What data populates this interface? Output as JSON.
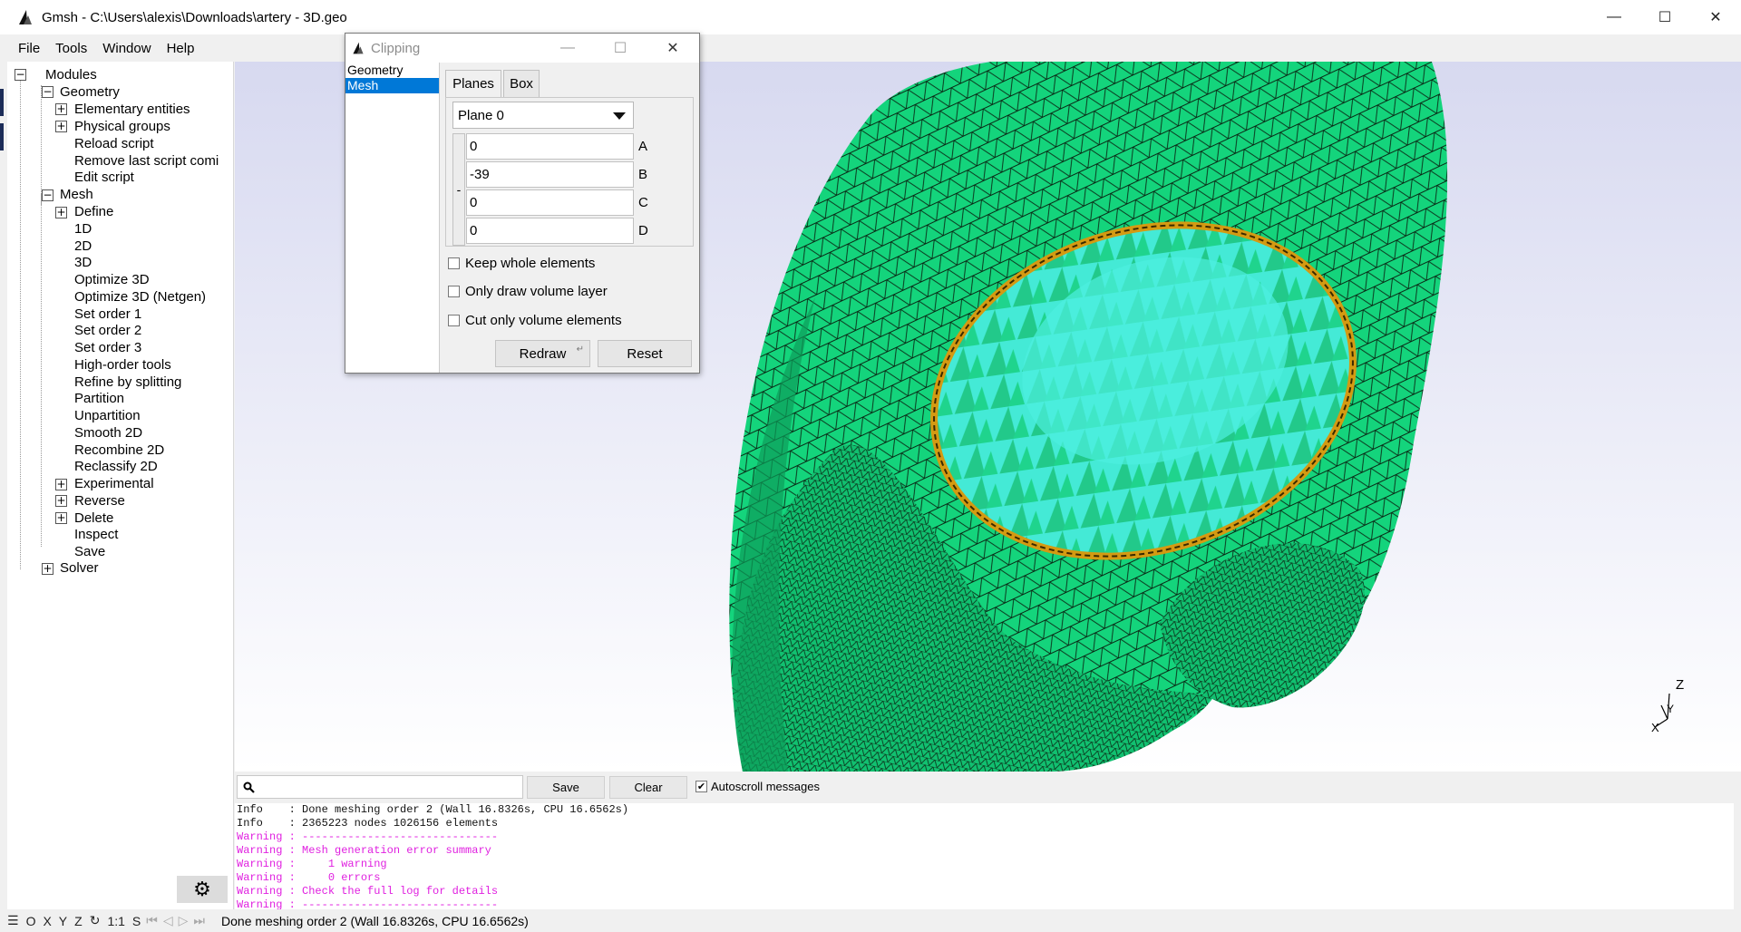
{
  "window": {
    "title": "Gmsh - C:\\Users\\alexis\\Downloads\\artery - 3D.geo",
    "min_symbol": "—",
    "max_symbol": "☐",
    "close_symbol": "✕"
  },
  "menu": {
    "items": [
      "File",
      "Tools",
      "Window",
      "Help"
    ]
  },
  "tree": {
    "modules": "Modules",
    "geometry": "Geometry",
    "geometry_items": [
      "Elementary entities",
      "Physical groups",
      "Reload script",
      "Remove last script comi",
      "Edit script"
    ],
    "mesh": "Mesh",
    "mesh_items": [
      "Define",
      "1D",
      "2D",
      "3D",
      "Optimize 3D",
      "Optimize 3D (Netgen)",
      "Set order 1",
      "Set order 2",
      "Set order 3",
      "High-order tools",
      "Refine by splitting",
      "Partition",
      "Unpartition",
      "Smooth 2D",
      "Recombine 2D",
      "Reclassify 2D",
      "Experimental",
      "Reverse",
      "Delete",
      "Inspect",
      "Save"
    ],
    "solver": "Solver",
    "plus": "+",
    "minus": "−"
  },
  "messages": {
    "save_label": "Save",
    "clear_label": "Clear",
    "autoscroll_label": "Autoscroll messages",
    "autoscroll_checked": "✔",
    "lines": [
      {
        "type": "info",
        "text": "Info    : Done meshing order 2 (Wall 16.8326s, CPU 16.6562s)"
      },
      {
        "type": "info",
        "text": "Info    : 2365223 nodes 1026156 elements"
      },
      {
        "type": "warn",
        "text": "Warning : ------------------------------"
      },
      {
        "type": "warn",
        "text": "Warning : Mesh generation error summary"
      },
      {
        "type": "warn",
        "text": "Warning :     1 warning"
      },
      {
        "type": "warn",
        "text": "Warning :     0 errors"
      },
      {
        "type": "warn",
        "text": "Warning : Check the full log for details"
      },
      {
        "type": "warn",
        "text": "Warning : ------------------------------"
      }
    ]
  },
  "statusbar": {
    "items": [
      "☰",
      "O",
      "X",
      "Y",
      "Z",
      "↻",
      "1:1",
      "S"
    ],
    "nav": [
      "⏮",
      "◁",
      "▷",
      "⏭"
    ],
    "message": "Done meshing order 2 (Wall 16.8326s, CPU 16.6562s)"
  },
  "clipping": {
    "title": "Clipping",
    "list": [
      "Geometry",
      "Mesh"
    ],
    "selected": "Mesh",
    "tabs": [
      "Planes",
      "Box"
    ],
    "plane": "Plane 0",
    "coefficients": [
      {
        "label": "A",
        "value": "0"
      },
      {
        "label": "B",
        "value": "-39"
      },
      {
        "label": "C",
        "value": "0"
      },
      {
        "label": "D",
        "value": "0"
      }
    ],
    "minus_btn": "-",
    "checks": [
      "Keep whole elements",
      "Only draw volume layer",
      "Cut only volume elements"
    ],
    "redraw": "Redraw",
    "reset": "Reset"
  },
  "axes": {
    "z": "Z",
    "y": "Y",
    "x": "X"
  },
  "colors": {
    "mesh_green": "#12d67c",
    "inner_cyan": "#3de8cf",
    "background_top": "#d8daf0",
    "background_bottom": "#ffffff",
    "warning": "#e020e0",
    "selection": "#0078d7"
  }
}
